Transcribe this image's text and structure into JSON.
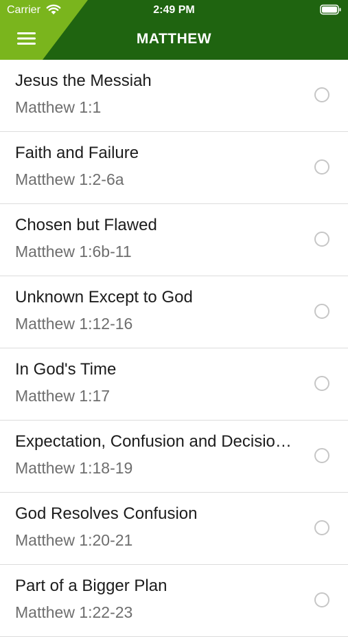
{
  "status_bar": {
    "carrier": "Carrier",
    "time": "2:49 PM"
  },
  "header": {
    "title": "MATTHEW",
    "menu_icon": "hamburger-icon",
    "background_color": "#1f6410",
    "accent_color": "#7ab51d"
  },
  "devotions": [
    {
      "title": "Jesus the Messiah",
      "reference": "Matthew 1:1"
    },
    {
      "title": "Faith and Failure",
      "reference": "Matthew 1:2-6a"
    },
    {
      "title": "Chosen but Flawed",
      "reference": "Matthew 1:6b-11"
    },
    {
      "title": "Unknown Except to God",
      "reference": "Matthew 1:12-16"
    },
    {
      "title": "In God's Time",
      "reference": "Matthew 1:17"
    },
    {
      "title": "Expectation, Confusion and Decisio…",
      "reference": "Matthew 1:18-19"
    },
    {
      "title": "God Resolves Confusion",
      "reference": "Matthew 1:20-21"
    },
    {
      "title": "Part of a Bigger Plan",
      "reference": "Matthew 1:22-23"
    }
  ]
}
